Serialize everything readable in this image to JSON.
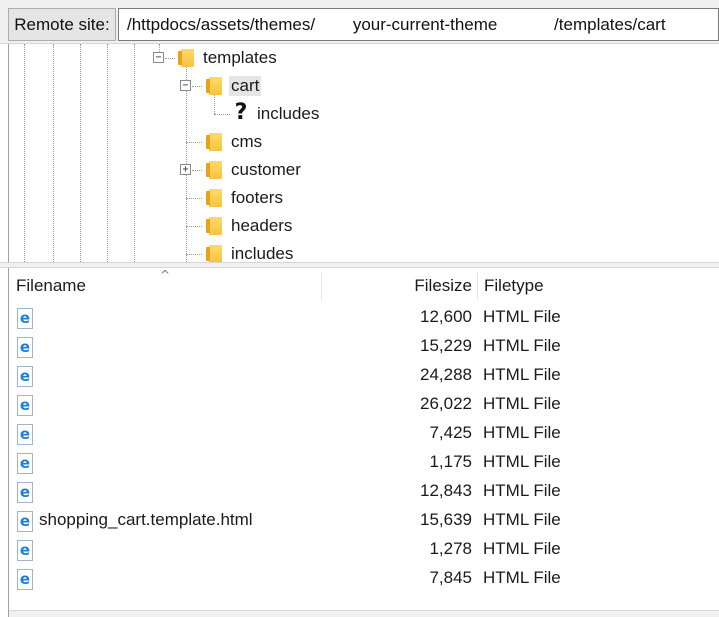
{
  "remote_site": {
    "label": "Remote site:",
    "path": "/httpdocs/assets/themes/        your-current-theme            /templates/cart"
  },
  "tree": {
    "items": [
      {
        "label": "templates",
        "icon": "folder-icon",
        "expander": "⊟"
      },
      {
        "label": "cart",
        "icon": "folder-icon",
        "expander": "⊟",
        "selected": true
      },
      {
        "label": "includes",
        "icon": "question-mark-icon"
      },
      {
        "label": "cms",
        "icon": "folder-icon"
      },
      {
        "label": "customer",
        "icon": "folder-icon",
        "expander": "⊞"
      },
      {
        "label": "footers",
        "icon": "folder-icon"
      },
      {
        "label": "headers",
        "icon": "folder-icon"
      },
      {
        "label": "includes",
        "icon": "folder-icon"
      }
    ]
  },
  "file_list": {
    "columns": {
      "filename": "Filename",
      "filesize": "Filesize",
      "filetype": "Filetype"
    },
    "rows": [
      {
        "name": "",
        "size": "12,600",
        "type": "HTML File",
        "icon": "html-file-icon"
      },
      {
        "name": "",
        "size": "15,229",
        "type": "HTML File",
        "icon": "html-file-icon"
      },
      {
        "name": "",
        "size": "24,288",
        "type": "HTML File",
        "icon": "html-file-icon"
      },
      {
        "name": "",
        "size": "26,022",
        "type": "HTML File",
        "icon": "html-file-icon"
      },
      {
        "name": "",
        "size": "7,425",
        "type": "HTML File",
        "icon": "html-file-icon"
      },
      {
        "name": "",
        "size": "1,175",
        "type": "HTML File",
        "icon": "html-file-icon"
      },
      {
        "name": "",
        "size": "12,843",
        "type": "HTML File",
        "icon": "html-file-icon"
      },
      {
        "name": "shopping_cart.template.html",
        "size": "15,639",
        "type": "HTML File",
        "icon": "html-file-icon"
      },
      {
        "name": "",
        "size": "1,278",
        "type": "HTML File",
        "icon": "html-file-icon"
      },
      {
        "name": "",
        "size": "7,845",
        "type": "HTML File",
        "icon": "html-file-icon"
      }
    ]
  },
  "colors": {
    "folder": "#f6c343",
    "ie_icon": "#1f7fd8",
    "selection": "#e5e5e5"
  }
}
